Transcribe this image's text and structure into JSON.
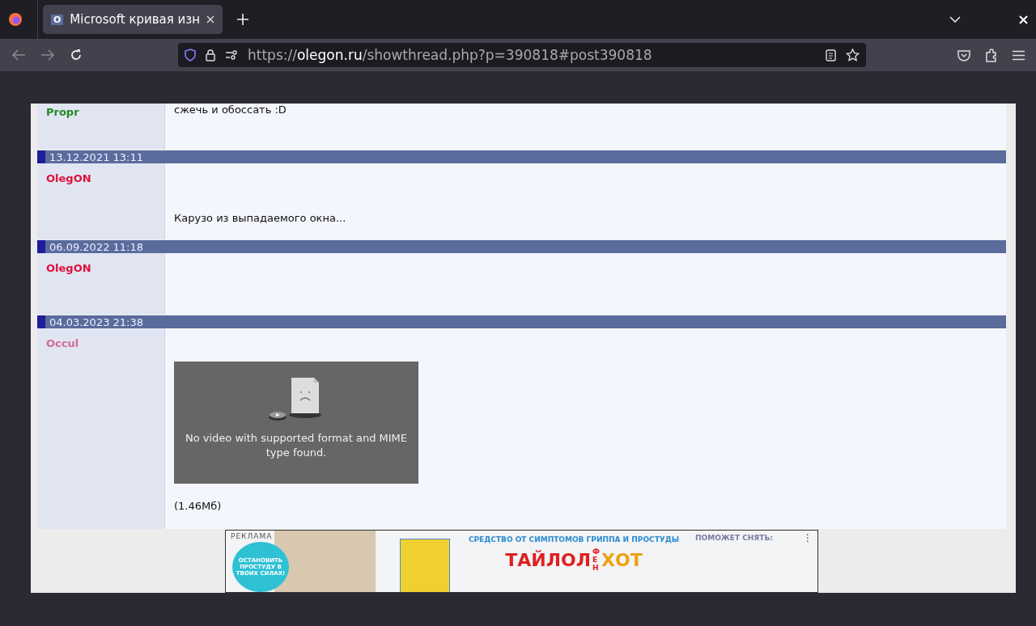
{
  "browser": {
    "tabs": [
      {
        "favicon": "O",
        "title": "Microsoft кривая изн",
        "selected": true
      }
    ],
    "address": {
      "prefix": "https://",
      "host": "olegon.ru",
      "path": "/showthread.php?p=390818#post390818"
    }
  },
  "posts": [
    {
      "author": "Propr",
      "color": "#228b22",
      "body": [
        {
          "kind": "text",
          "text": "сжечь и обоссать :D"
        }
      ]
    },
    {
      "date": "13.12.2021 13:11",
      "author": "OlegON",
      "color": "#e0103a",
      "body": [
        {
          "kind": "spacer"
        },
        {
          "kind": "text",
          "text": "Карузо из выпадаемого окна..."
        }
      ]
    },
    {
      "date": "06.09.2022 11:18",
      "author": "OlegON",
      "color": "#e0103a"
    },
    {
      "date": "04.03.2023 21:38",
      "author": "Occul",
      "color": "#d06a90",
      "body": [
        {
          "kind": "video",
          "text": "No video with supported format and MIME type found."
        },
        {
          "kind": "text",
          "text": "(1.46Мб)"
        }
      ]
    }
  ],
  "ad": {
    "label": "РЕКЛАМА",
    "circle_text": "ОСТАНОВИТЬ ПРОСТУДУ В ТВОИХ СИЛАХ!",
    "headline": "СРЕДСТВО ОТ СИМПТОМОВ ГРИППА И ПРОСТУДЫ",
    "brand": "ТАЙЛОЛ",
    "brand_small": "ФЕН",
    "brand_end": "ХОТ",
    "side_text": "ПОМОЖЕТ СНЯТЬ:",
    "menu": "⋮"
  }
}
